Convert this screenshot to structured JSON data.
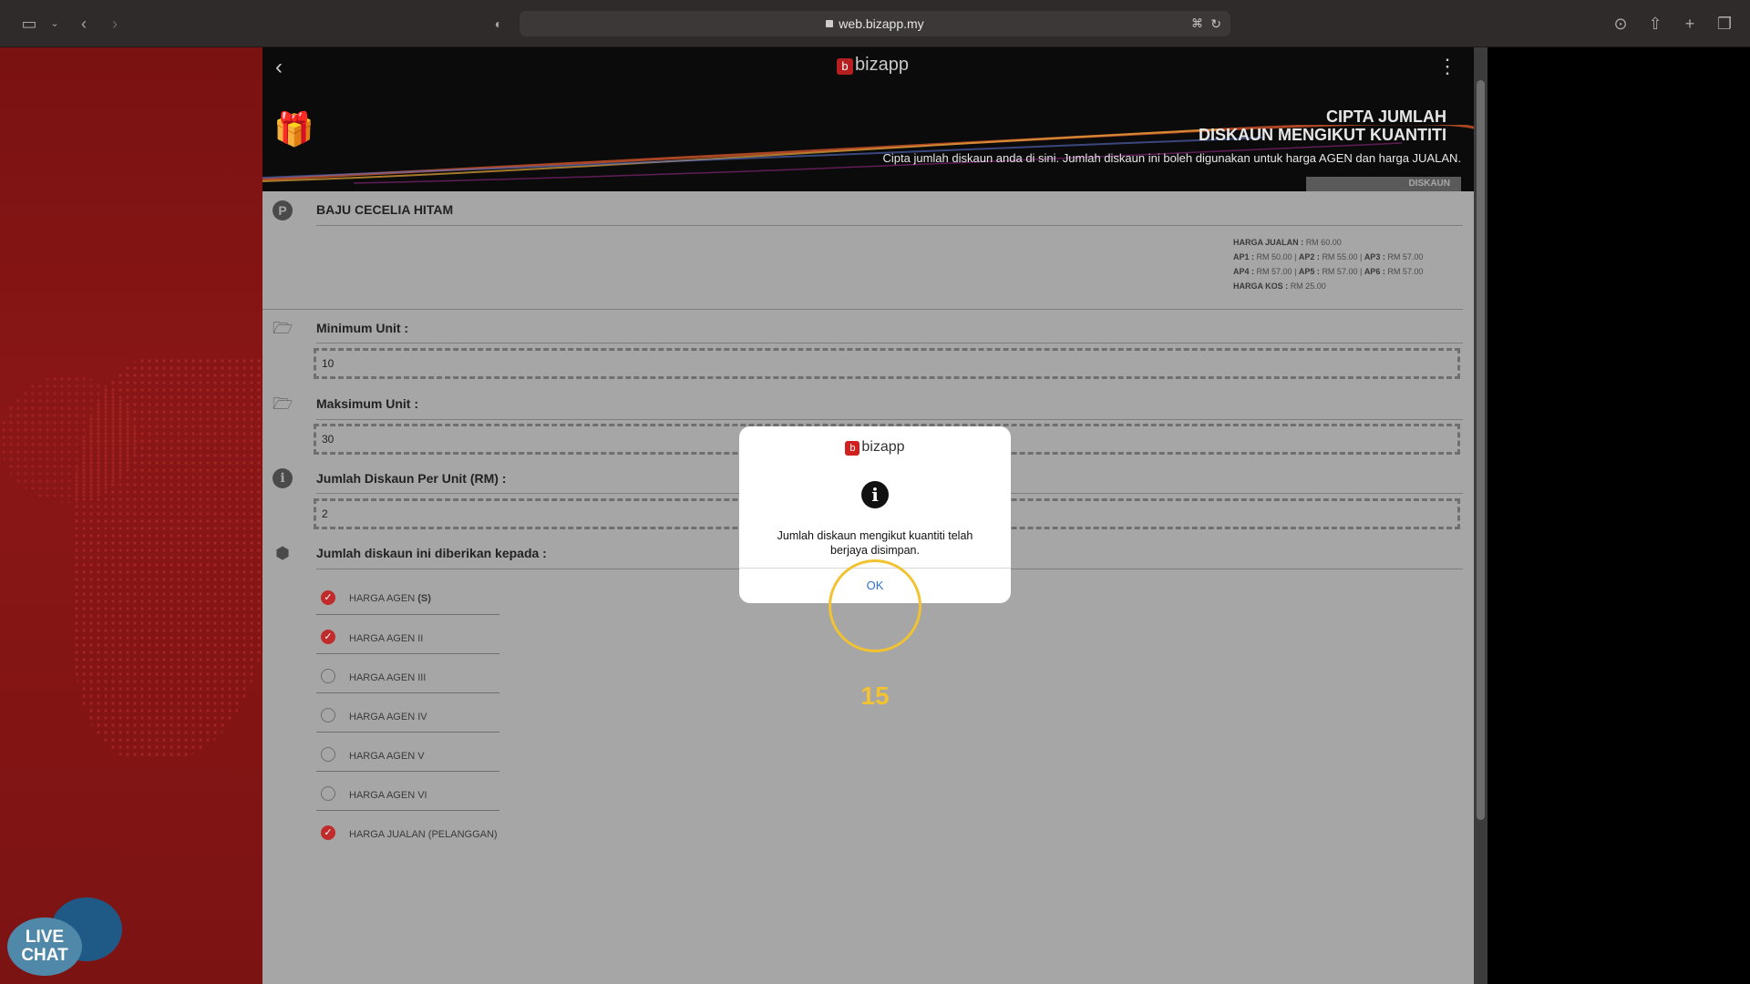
{
  "browser": {
    "url": "web.bizapp.my"
  },
  "header": {
    "logo_text": "bizapp",
    "title_line1": "CIPTA JUMLAH",
    "title_line2": "DISKAUN MENGIKUT KUANTITI",
    "subtitle": "Cipta jumlah diskaun anda di sini. Jumlah diskaun ini boleh digunakan untuk harga AGEN dan harga JUALAN.",
    "tag": "DISKAUN"
  },
  "product": {
    "name": "BAJU CECELIA HITAM",
    "prices": {
      "line1_label": "HARGA JUALAN :",
      "line1_value": "RM 60.00",
      "ap1_label": "AP1 :",
      "ap1_value": "RM 50.00",
      "ap2_label": "AP2 :",
      "ap2_value": "RM 55.00",
      "ap3_label": "AP3 :",
      "ap3_value": "RM 57.00",
      "ap4_label": "AP4 :",
      "ap4_value": "RM 57.00",
      "ap5_label": "AP5 :",
      "ap5_value": "RM 57.00",
      "ap6_label": "AP6 :",
      "ap6_value": "RM 57.00",
      "kos_label": "HARGA KOS :",
      "kos_value": "RM 25.00"
    }
  },
  "form": {
    "min_label": "Minimum Unit :",
    "min_value": "10",
    "max_label": "Maksimum Unit :",
    "max_value": "30",
    "disc_label": "Jumlah Diskaun Per Unit (RM) :",
    "disc_value": "2",
    "given_label": "Jumlah diskaun ini diberikan kepada :"
  },
  "options": [
    {
      "label": "HARGA AGEN",
      "suffix": "(S)",
      "checked": true
    },
    {
      "label": "HARGA AGEN II",
      "checked": true
    },
    {
      "label": "HARGA AGEN III",
      "checked": false
    },
    {
      "label": "HARGA AGEN IV",
      "checked": false
    },
    {
      "label": "HARGA AGEN V",
      "checked": false
    },
    {
      "label": "HARGA AGEN VI",
      "checked": false
    },
    {
      "label": "HARGA JUALAN (PELANGGAN)",
      "checked": true
    }
  ],
  "dialog": {
    "logo_text": "bizapp",
    "message": "Jumlah diskaun mengikut kuantiti telah berjaya disimpan.",
    "ok_label": "OK"
  },
  "overlay": {
    "step_number": "15"
  },
  "livechat": {
    "line1": "LIVE",
    "line2": "CHAT"
  },
  "colors": {
    "accent_red": "#c12b2b",
    "link_blue": "#2a6fd1",
    "highlight_yellow": "#f1c232"
  }
}
